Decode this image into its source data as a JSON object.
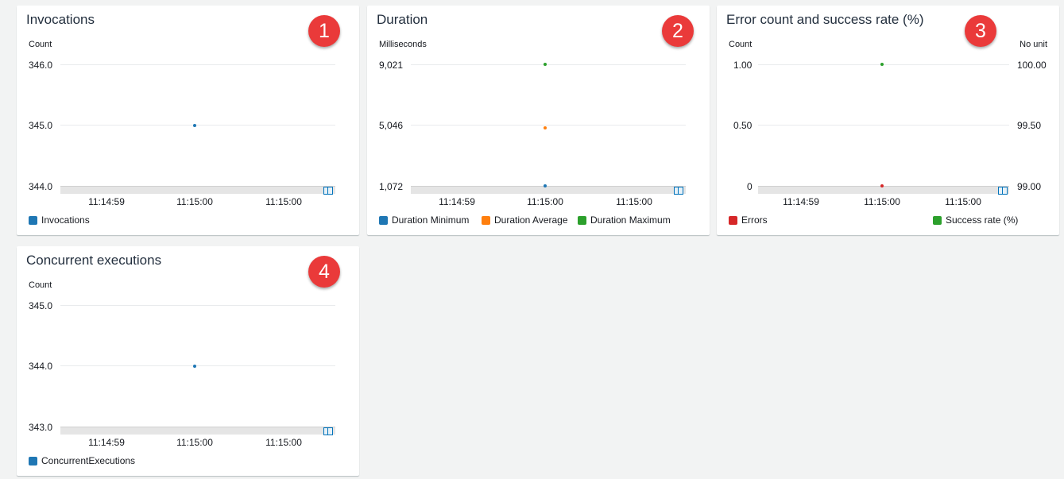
{
  "colors": {
    "blue": "#1f77b4",
    "orange": "#ff7f0e",
    "green": "#2ca02c",
    "red": "#d62728"
  },
  "widgets": [
    {
      "title": "Invocations",
      "badge": "1",
      "unit_left": "Count",
      "y_ticks": [
        "346.0",
        "345.0",
        "344.0"
      ],
      "x_ticks": [
        "11:14:59",
        "11:15:00",
        "11:15:00"
      ],
      "legend": [
        {
          "label": "Invocations",
          "color": "#1f77b4"
        }
      ]
    },
    {
      "title": "Duration",
      "badge": "2",
      "unit_left": "Milliseconds",
      "y_ticks": [
        "9,021",
        "5,046",
        "1,072"
      ],
      "x_ticks": [
        "11:14:59",
        "11:15:00",
        "11:15:00"
      ],
      "legend": [
        {
          "label": "Duration Minimum",
          "color": "#1f77b4"
        },
        {
          "label": "Duration Average",
          "color": "#ff7f0e"
        },
        {
          "label": "Duration Maximum",
          "color": "#2ca02c"
        }
      ]
    },
    {
      "title": "Error count and success rate (%)",
      "badge": "3",
      "unit_left": "Count",
      "unit_right": "No unit",
      "y_ticks": [
        "1.00",
        "0.50",
        "0"
      ],
      "y_ticks_right": [
        "100.00",
        "99.50",
        "99.00"
      ],
      "x_ticks": [
        "11:14:59",
        "11:15:00",
        "11:15:00"
      ],
      "legend": [
        {
          "label": "Errors",
          "color": "#d62728"
        },
        {
          "label": "Success rate (%)",
          "color": "#2ca02c"
        }
      ]
    },
    {
      "title": "Concurrent executions",
      "badge": "4",
      "unit_left": "Count",
      "y_ticks": [
        "345.0",
        "344.0",
        "343.0"
      ],
      "x_ticks": [
        "11:14:59",
        "11:15:00",
        "11:15:00"
      ],
      "legend": [
        {
          "label": "ConcurrentExecutions",
          "color": "#1f77b4"
        }
      ]
    }
  ],
  "chart_data": [
    {
      "type": "scatter",
      "title": "Invocations",
      "ylabel": "Count",
      "ylim": [
        344,
        346
      ],
      "x": [
        "11:15:00"
      ],
      "series": [
        {
          "name": "Invocations",
          "values": [
            345
          ]
        }
      ]
    },
    {
      "type": "scatter",
      "title": "Duration",
      "ylabel": "Milliseconds",
      "ylim": [
        1072,
        9021
      ],
      "x": [
        "11:15:00"
      ],
      "series": [
        {
          "name": "Duration Minimum",
          "values": [
            1072
          ]
        },
        {
          "name": "Duration Average",
          "values": [
            4850
          ]
        },
        {
          "name": "Duration Maximum",
          "values": [
            9021
          ]
        }
      ]
    },
    {
      "type": "scatter",
      "title": "Error count and success rate (%)",
      "ylabel": "Count",
      "ylabel_right": "No unit",
      "ylim": [
        0,
        1
      ],
      "ylim_right": [
        99,
        100
      ],
      "x": [
        "11:15:00"
      ],
      "series": [
        {
          "name": "Errors",
          "values": [
            0
          ],
          "axis": "left"
        },
        {
          "name": "Success rate (%)",
          "values": [
            100
          ],
          "axis": "right"
        }
      ]
    },
    {
      "type": "scatter",
      "title": "Concurrent executions",
      "ylabel": "Count",
      "ylim": [
        343,
        345
      ],
      "x": [
        "11:15:00"
      ],
      "series": [
        {
          "name": "ConcurrentExecutions",
          "values": [
            344
          ]
        }
      ]
    }
  ]
}
